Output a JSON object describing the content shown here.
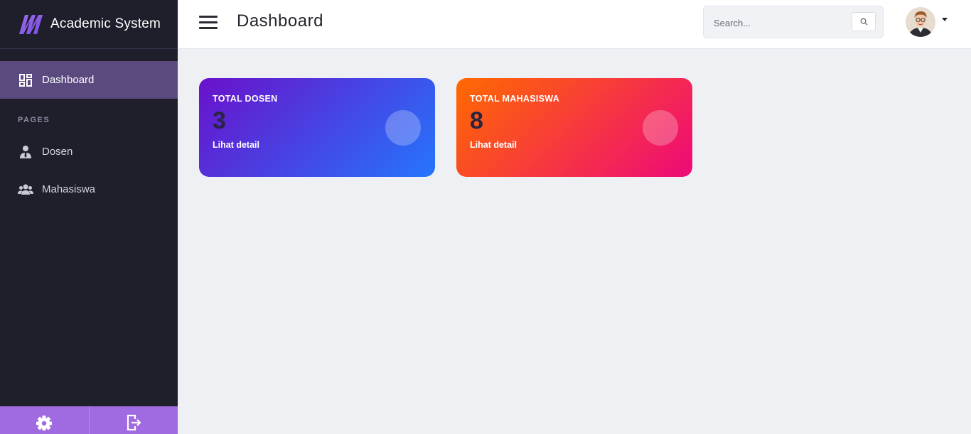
{
  "app": {
    "name": "Academic System"
  },
  "sidebar": {
    "active": {
      "label": "Dashboard",
      "icon": "dashboard-icon"
    },
    "section_label": "PAGES",
    "items": [
      {
        "label": "Dosen",
        "icon": "user-tie-icon"
      },
      {
        "label": "Mahasiswa",
        "icon": "users-icon"
      }
    ],
    "footer": {
      "settings_icon": "gear-icon",
      "logout_icon": "logout-icon"
    }
  },
  "header": {
    "title": "Dashboard",
    "search": {
      "placeholder": "Search..."
    }
  },
  "cards": [
    {
      "title": "TOTAL DOSEN",
      "value": "3",
      "link": "Lihat detail",
      "colors": [
        "#6a11cb",
        "#2575fc"
      ]
    },
    {
      "title": "TOTAL MAHASISWA",
      "value": "8",
      "link": "Lihat detail",
      "colors": [
        "#ff6a00",
        "#ee0979"
      ]
    }
  ],
  "colors": {
    "sidebar_bg": "#1e1f2a",
    "active_item": "#5b4a80",
    "footer_bg": "#a06ae0",
    "page_bg": "#eff0f4"
  }
}
